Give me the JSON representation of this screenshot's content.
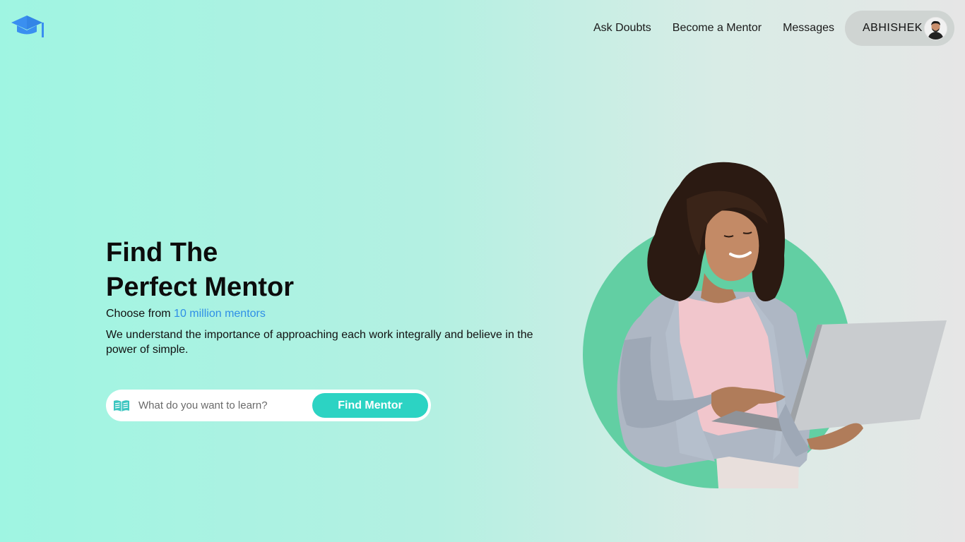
{
  "nav": {
    "links": [
      "Ask Doubts",
      "Become a Mentor",
      "Messages"
    ],
    "user_name": "ABHISHEK"
  },
  "hero": {
    "title_line1": "Find The",
    "title_line2": "Perfect Mentor",
    "sub_prefix": "Choose from ",
    "sub_highlight": "10 million mentors",
    "description": "We understand the importance of approaching each work integrally and believe in the power of simple."
  },
  "search": {
    "placeholder": "What do you want to learn?",
    "button_label": "Find Mentor"
  },
  "icons": {
    "logo": "graduation-cap-icon",
    "search": "open-book-icon"
  },
  "colors": {
    "accent_blue": "#2f8fe6",
    "button_teal": "#2cd3c3",
    "circle_green": "#62cfa3",
    "logo_blue": "#3a8ff0"
  }
}
